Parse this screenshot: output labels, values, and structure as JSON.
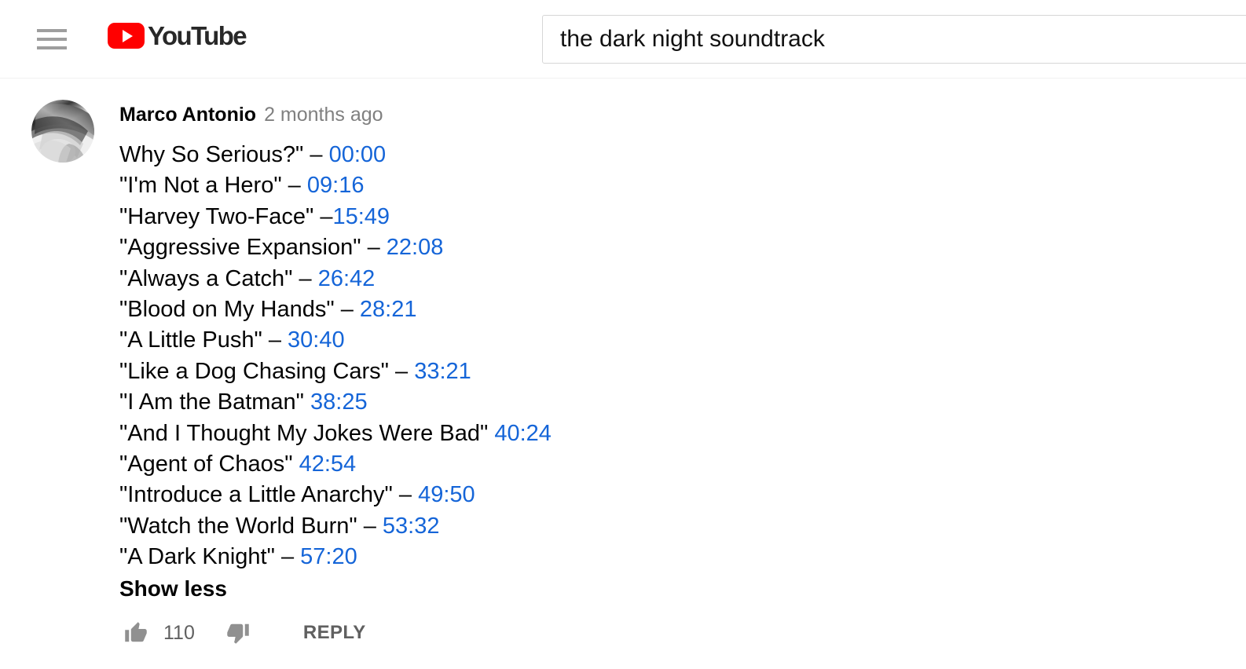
{
  "header": {
    "guide_icon": "hamburger-menu-icon",
    "logo_text": "YouTube",
    "logo_icon": "youtube-play-icon",
    "brand_color": "#ff0000",
    "search": {
      "value": "the dark night soundtrack",
      "placeholder": "Search"
    }
  },
  "comment": {
    "avatar_icon": "user-avatar-photo",
    "author": "Marco Antonio",
    "published_time": "2 months ago",
    "timestamp_link_color": "#1565d8",
    "lines": [
      {
        "text": "Why So Serious?\" – ",
        "time": "00:00"
      },
      {
        "text": "\"I'm Not a Hero\" – ",
        "time": "09:16"
      },
      {
        "text": "\"Harvey Two-Face\" –",
        "time": "15:49"
      },
      {
        "text": "\"Aggressive Expansion\" – ",
        "time": "22:08"
      },
      {
        "text": "\"Always a Catch\" – ",
        "time": "26:42"
      },
      {
        "text": "\"Blood on My Hands\" – ",
        "time": "28:21"
      },
      {
        "text": "\"A Little Push\" – ",
        "time": "30:40"
      },
      {
        "text": "\"Like a Dog Chasing Cars\" – ",
        "time": "33:21"
      },
      {
        "text": "\"I Am the Batman\" ",
        "time": "38:25"
      },
      {
        "text": "\"And I Thought My Jokes Were Bad\" ",
        "time": "40:24"
      },
      {
        "text": "\"Agent of Chaos\" ",
        "time": "42:54"
      },
      {
        "text": "\"Introduce a Little Anarchy\" – ",
        "time": "49:50"
      },
      {
        "text": "\"Watch the World Burn\" – ",
        "time": "53:32"
      },
      {
        "text": "\"A Dark Knight\" – ",
        "time": "57:20"
      }
    ],
    "expander_label": "Show less",
    "actions": {
      "like_icon": "thumbs-up-icon",
      "like_count": "110",
      "dislike_icon": "thumbs-down-icon",
      "reply_label": "REPLY"
    }
  }
}
